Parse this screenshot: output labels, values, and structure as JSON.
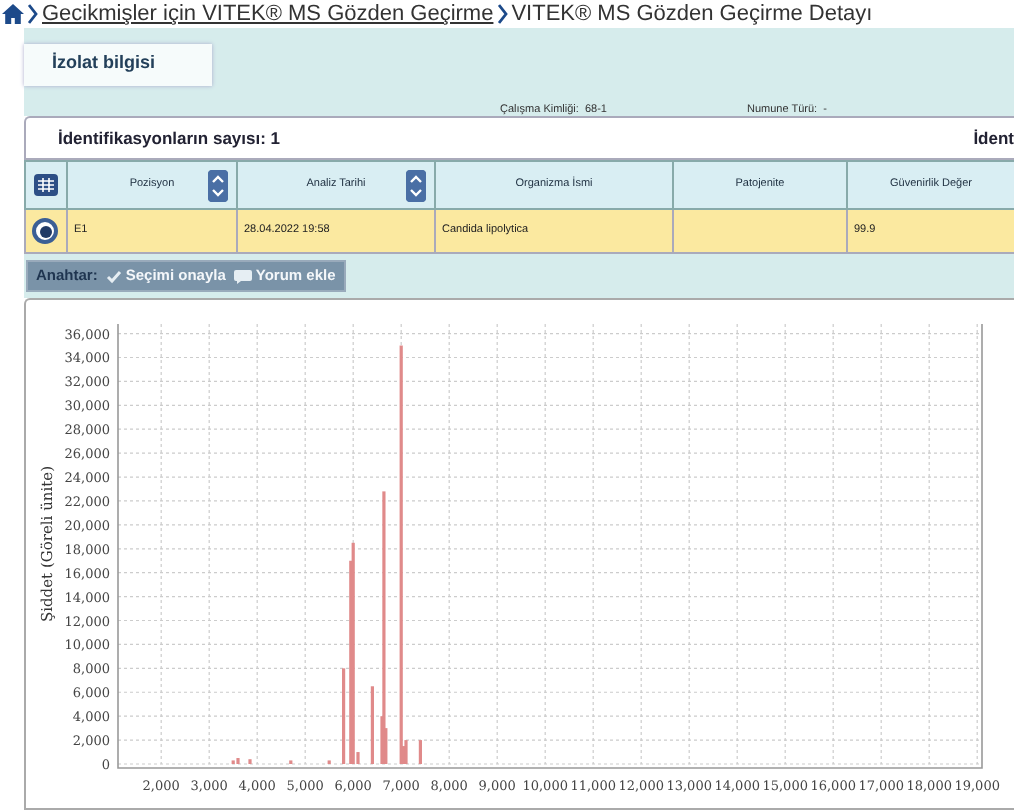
{
  "breadcrumb": {
    "link": "Gecikmişler için VITEK® MS Gözden Geçirme",
    "current": "VITEK® MS Gözden Geçirme Detayı"
  },
  "isolate_panel": {
    "tab": {
      "label": "İzolat bilgisi",
      "selected": true
    },
    "fields": [
      {
        "label": "Çalışma Kimliği:",
        "value": "68-1"
      },
      {
        "label": "Numune Türü:",
        "value": "-"
      }
    ]
  },
  "identifications": {
    "count_label": "İdentifikasyonların sayısı: 1",
    "right_label": "İdent"
  },
  "table": {
    "columns": [
      {
        "label": "Pozisyon",
        "sortable": true
      },
      {
        "label": "Analiz Tarihi",
        "sortable": true
      },
      {
        "label": "Organizma İsmi",
        "sortable": false
      },
      {
        "label": "Patojenite",
        "sortable": false
      },
      {
        "label": "Güvenirlik Değer",
        "sortable": false
      }
    ],
    "rows": [
      {
        "selected": true,
        "cells": [
          "E1",
          "28.04.2022 19:58",
          "Candida lipolytica",
          "",
          "99.9"
        ]
      }
    ]
  },
  "toolbar": {
    "label": "Anahtar:",
    "buttons": [
      {
        "kind": "check",
        "label": "Seçimi onayla",
        "disabled": true
      },
      {
        "kind": "comment",
        "label": "Yorum ekle",
        "disabled": true
      }
    ]
  },
  "chart_data": {
    "type": "bar",
    "ylabel": "Şiddet (Göreli ünite)",
    "x": [
      3500,
      3600,
      3850,
      4700,
      5500,
      5800,
      5950,
      6000,
      6100,
      6400,
      6600,
      6640,
      6680,
      7000,
      7050,
      7100,
      7400
    ],
    "series": [
      {
        "color": "#e08a8a",
        "values": [
          300,
          500,
          400,
          300,
          300,
          8000,
          17000,
          18500,
          1000,
          6500,
          4000,
          22800,
          3000,
          35000,
          1500,
          2000,
          2000
        ]
      }
    ],
    "grid": true,
    "xlim": [
      1100,
      19100
    ],
    "ylim": [
      0,
      36800
    ],
    "xticks": [
      {
        "value": 2000,
        "label": "2,000"
      },
      {
        "value": 3000,
        "label": "3,000"
      },
      {
        "value": 4000,
        "label": "4,000"
      },
      {
        "value": 5000,
        "label": "5,000"
      },
      {
        "value": 6000,
        "label": "6,000"
      },
      {
        "value": 7000,
        "label": "7,000"
      },
      {
        "value": 8000,
        "label": "8,000"
      },
      {
        "value": 9000,
        "label": "9,000"
      },
      {
        "value": 10000,
        "label": "10,000"
      },
      {
        "value": 11000,
        "label": "11,000"
      },
      {
        "value": 12000,
        "label": "12,000"
      },
      {
        "value": 13000,
        "label": "13,000"
      },
      {
        "value": 14000,
        "label": "14,000"
      },
      {
        "value": 15000,
        "label": "15,000"
      },
      {
        "value": 16000,
        "label": "16,000"
      },
      {
        "value": 17000,
        "label": "17,000"
      },
      {
        "value": 18000,
        "label": "18,000"
      },
      {
        "value": 19000,
        "label": "19,000"
      }
    ],
    "yticks": [
      {
        "value": 0,
        "label": "0"
      },
      {
        "value": 2000,
        "label": "2,000"
      },
      {
        "value": 4000,
        "label": "4,000"
      },
      {
        "value": 6000,
        "label": "6,000"
      },
      {
        "value": 8000,
        "label": "8,000"
      },
      {
        "value": 10000,
        "label": "10,000"
      },
      {
        "value": 12000,
        "label": "12,000"
      },
      {
        "value": 14000,
        "label": "14,000"
      },
      {
        "value": 16000,
        "label": "16,000"
      },
      {
        "value": 18000,
        "label": "18,000"
      },
      {
        "value": 20000,
        "label": "20,000"
      },
      {
        "value": 22000,
        "label": "22,000"
      },
      {
        "value": 24000,
        "label": "24,000"
      },
      {
        "value": 26000,
        "label": "26,000"
      },
      {
        "value": 28000,
        "label": "28,000"
      },
      {
        "value": 30000,
        "label": "30,000"
      },
      {
        "value": 32000,
        "label": "32,000"
      },
      {
        "value": 34000,
        "label": "34,000"
      },
      {
        "value": 36000,
        "label": "36,000"
      }
    ]
  }
}
